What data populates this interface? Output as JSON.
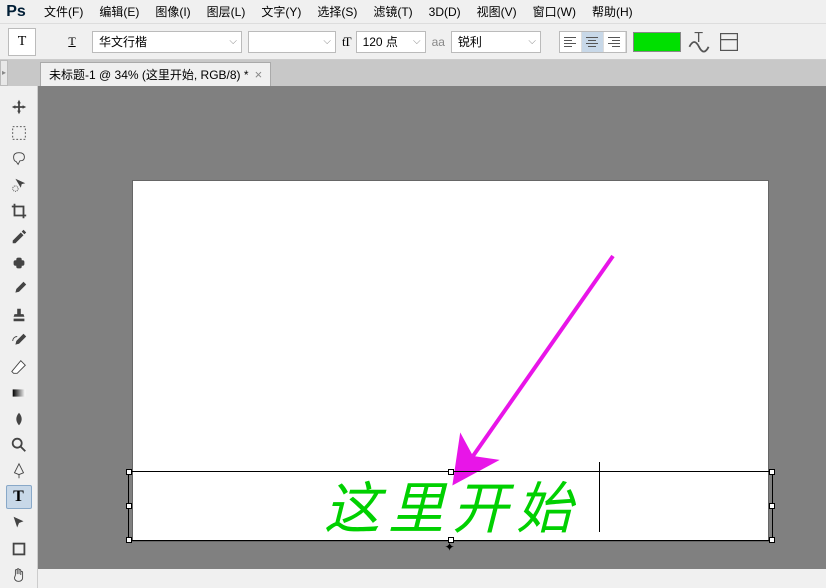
{
  "menu": {
    "items": [
      "文件(F)",
      "编辑(E)",
      "图像(I)",
      "图层(L)",
      "文字(Y)",
      "选择(S)",
      "滤镜(T)",
      "3D(D)",
      "视图(V)",
      "窗口(W)",
      "帮助(H)"
    ]
  },
  "options": {
    "tool_letter": "T",
    "orientation_icon": "T",
    "font_family": "华文行楷",
    "font_style": "",
    "size_icon": "tT",
    "font_size": "120 点",
    "aa_label": "aa",
    "anti_alias": "锐利",
    "text_color": "#00e000"
  },
  "tab": {
    "title": "未标题-1 @ 34% (这里开始, RGB/8) *",
    "close": "×"
  },
  "canvas": {
    "text_content": "这里开始"
  },
  "tools": [
    {
      "name": "move-tool"
    },
    {
      "name": "marquee-tool"
    },
    {
      "name": "lasso-tool"
    },
    {
      "name": "quick-select-tool"
    },
    {
      "name": "crop-tool"
    },
    {
      "name": "eyedropper-tool"
    },
    {
      "name": "healing-tool"
    },
    {
      "name": "brush-tool"
    },
    {
      "name": "stamp-tool"
    },
    {
      "name": "history-brush-tool"
    },
    {
      "name": "eraser-tool"
    },
    {
      "name": "gradient-tool"
    },
    {
      "name": "blur-tool"
    },
    {
      "name": "dodge-tool"
    },
    {
      "name": "pen-tool"
    },
    {
      "name": "type-tool",
      "active": true,
      "letter": "T"
    },
    {
      "name": "path-select-tool"
    },
    {
      "name": "shape-tool"
    },
    {
      "name": "hand-tool"
    }
  ]
}
